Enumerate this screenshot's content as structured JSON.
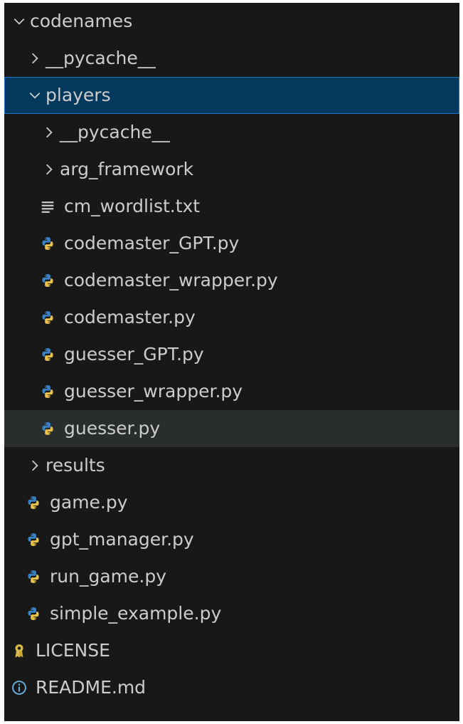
{
  "explorer": {
    "items": [
      {
        "label": "codenames",
        "type": "folder",
        "expanded": true,
        "depth": 0
      },
      {
        "label": "__pycache__",
        "type": "folder",
        "expanded": false,
        "depth": 1
      },
      {
        "label": "players",
        "type": "folder",
        "expanded": true,
        "depth": 1,
        "selected": true
      },
      {
        "label": "__pycache__",
        "type": "folder",
        "expanded": false,
        "depth": 2
      },
      {
        "label": "arg_framework",
        "type": "folder",
        "expanded": false,
        "depth": 2
      },
      {
        "label": "cm_wordlist.txt",
        "type": "text-file",
        "depth": 2
      },
      {
        "label": "codemaster_GPT.py",
        "type": "python-file",
        "depth": 2
      },
      {
        "label": "codemaster_wrapper.py",
        "type": "python-file",
        "depth": 2
      },
      {
        "label": "codemaster.py",
        "type": "python-file",
        "depth": 2
      },
      {
        "label": "guesser_GPT.py",
        "type": "python-file",
        "depth": 2
      },
      {
        "label": "guesser_wrapper.py",
        "type": "python-file",
        "depth": 2
      },
      {
        "label": "guesser.py",
        "type": "python-file",
        "depth": 2,
        "hovered": true
      },
      {
        "label": "results",
        "type": "folder",
        "expanded": false,
        "depth": 1
      },
      {
        "label": "game.py",
        "type": "python-file",
        "depth": 1
      },
      {
        "label": "gpt_manager.py",
        "type": "python-file",
        "depth": 1
      },
      {
        "label": "run_game.py",
        "type": "python-file",
        "depth": 1
      },
      {
        "label": "simple_example.py",
        "type": "python-file",
        "depth": 1
      },
      {
        "label": "LICENSE",
        "type": "license-file",
        "depth": 0
      },
      {
        "label": "README.md",
        "type": "info-file",
        "depth": 0
      }
    ]
  },
  "colors": {
    "background": "#181818",
    "text": "#cccccc",
    "selected_background": "#04395e",
    "selected_border": "#1e74c4",
    "hover_background": "#2a2d2e",
    "python_blue": "#3b82c4",
    "python_yellow": "#e8c04a",
    "license_yellow": "#d9b94a",
    "info_blue": "#69aede"
  }
}
